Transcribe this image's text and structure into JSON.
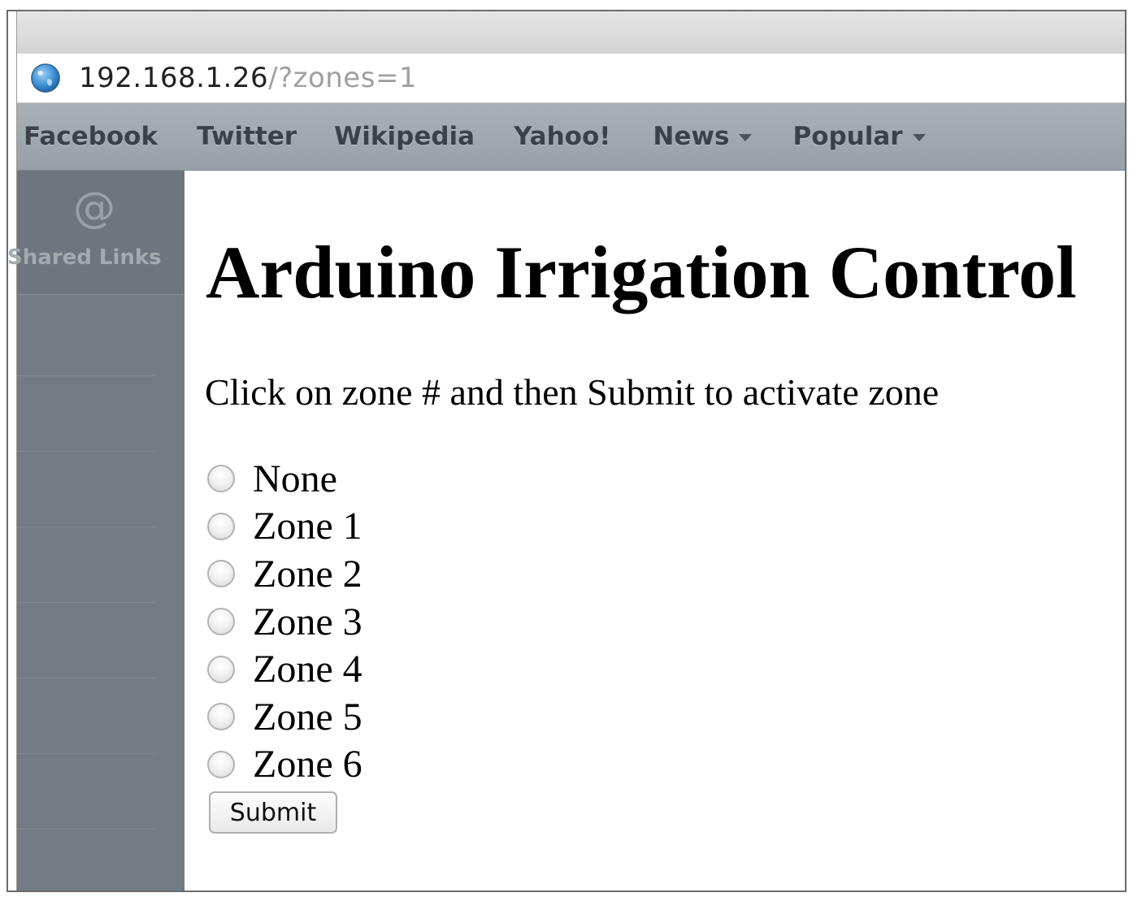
{
  "browser": {
    "url_host": "192.168.1.26",
    "url_path": "/?zones=1",
    "bookmarks": [
      "Facebook",
      "Twitter",
      "Wikipedia",
      "Yahoo!",
      "News",
      "Popular"
    ],
    "sidebar": {
      "icon": "at-icon",
      "label": "Shared Links"
    }
  },
  "page": {
    "title": "Arduino Irrigation Control",
    "instructions": "Click on zone # and then Submit to activate zone",
    "options": [
      "None",
      "Zone 1",
      "Zone 2",
      "Zone 3",
      "Zone 4",
      "Zone 5",
      "Zone 6"
    ],
    "submit_label": "Submit"
  }
}
